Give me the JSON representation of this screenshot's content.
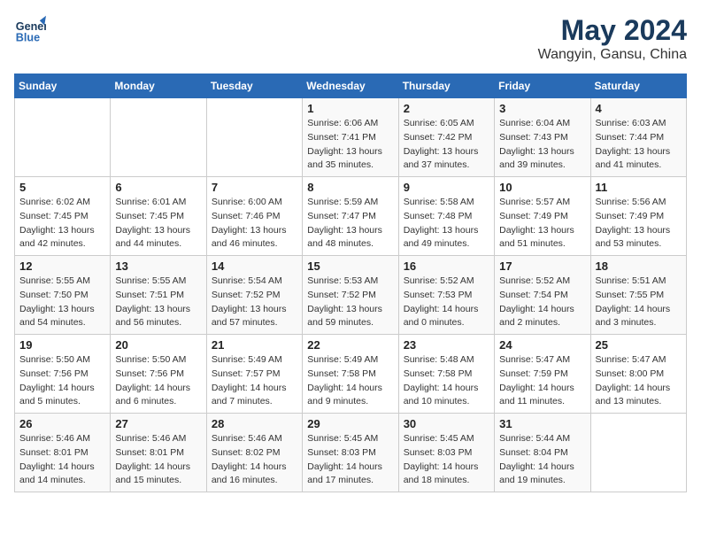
{
  "logo": {
    "line1": "General",
    "line2": "Blue"
  },
  "title": "May 2024",
  "subtitle": "Wangyin, Gansu, China",
  "weekdays": [
    "Sunday",
    "Monday",
    "Tuesday",
    "Wednesday",
    "Thursday",
    "Friday",
    "Saturday"
  ],
  "weeks": [
    [
      {
        "day": "",
        "info": ""
      },
      {
        "day": "",
        "info": ""
      },
      {
        "day": "",
        "info": ""
      },
      {
        "day": "1",
        "info": "Sunrise: 6:06 AM\nSunset: 7:41 PM\nDaylight: 13 hours\nand 35 minutes."
      },
      {
        "day": "2",
        "info": "Sunrise: 6:05 AM\nSunset: 7:42 PM\nDaylight: 13 hours\nand 37 minutes."
      },
      {
        "day": "3",
        "info": "Sunrise: 6:04 AM\nSunset: 7:43 PM\nDaylight: 13 hours\nand 39 minutes."
      },
      {
        "day": "4",
        "info": "Sunrise: 6:03 AM\nSunset: 7:44 PM\nDaylight: 13 hours\nand 41 minutes."
      }
    ],
    [
      {
        "day": "5",
        "info": "Sunrise: 6:02 AM\nSunset: 7:45 PM\nDaylight: 13 hours\nand 42 minutes."
      },
      {
        "day": "6",
        "info": "Sunrise: 6:01 AM\nSunset: 7:45 PM\nDaylight: 13 hours\nand 44 minutes."
      },
      {
        "day": "7",
        "info": "Sunrise: 6:00 AM\nSunset: 7:46 PM\nDaylight: 13 hours\nand 46 minutes."
      },
      {
        "day": "8",
        "info": "Sunrise: 5:59 AM\nSunset: 7:47 PM\nDaylight: 13 hours\nand 48 minutes."
      },
      {
        "day": "9",
        "info": "Sunrise: 5:58 AM\nSunset: 7:48 PM\nDaylight: 13 hours\nand 49 minutes."
      },
      {
        "day": "10",
        "info": "Sunrise: 5:57 AM\nSunset: 7:49 PM\nDaylight: 13 hours\nand 51 minutes."
      },
      {
        "day": "11",
        "info": "Sunrise: 5:56 AM\nSunset: 7:49 PM\nDaylight: 13 hours\nand 53 minutes."
      }
    ],
    [
      {
        "day": "12",
        "info": "Sunrise: 5:55 AM\nSunset: 7:50 PM\nDaylight: 13 hours\nand 54 minutes."
      },
      {
        "day": "13",
        "info": "Sunrise: 5:55 AM\nSunset: 7:51 PM\nDaylight: 13 hours\nand 56 minutes."
      },
      {
        "day": "14",
        "info": "Sunrise: 5:54 AM\nSunset: 7:52 PM\nDaylight: 13 hours\nand 57 minutes."
      },
      {
        "day": "15",
        "info": "Sunrise: 5:53 AM\nSunset: 7:52 PM\nDaylight: 13 hours\nand 59 minutes."
      },
      {
        "day": "16",
        "info": "Sunrise: 5:52 AM\nSunset: 7:53 PM\nDaylight: 14 hours\nand 0 minutes."
      },
      {
        "day": "17",
        "info": "Sunrise: 5:52 AM\nSunset: 7:54 PM\nDaylight: 14 hours\nand 2 minutes."
      },
      {
        "day": "18",
        "info": "Sunrise: 5:51 AM\nSunset: 7:55 PM\nDaylight: 14 hours\nand 3 minutes."
      }
    ],
    [
      {
        "day": "19",
        "info": "Sunrise: 5:50 AM\nSunset: 7:56 PM\nDaylight: 14 hours\nand 5 minutes."
      },
      {
        "day": "20",
        "info": "Sunrise: 5:50 AM\nSunset: 7:56 PM\nDaylight: 14 hours\nand 6 minutes."
      },
      {
        "day": "21",
        "info": "Sunrise: 5:49 AM\nSunset: 7:57 PM\nDaylight: 14 hours\nand 7 minutes."
      },
      {
        "day": "22",
        "info": "Sunrise: 5:49 AM\nSunset: 7:58 PM\nDaylight: 14 hours\nand 9 minutes."
      },
      {
        "day": "23",
        "info": "Sunrise: 5:48 AM\nSunset: 7:58 PM\nDaylight: 14 hours\nand 10 minutes."
      },
      {
        "day": "24",
        "info": "Sunrise: 5:47 AM\nSunset: 7:59 PM\nDaylight: 14 hours\nand 11 minutes."
      },
      {
        "day": "25",
        "info": "Sunrise: 5:47 AM\nSunset: 8:00 PM\nDaylight: 14 hours\nand 13 minutes."
      }
    ],
    [
      {
        "day": "26",
        "info": "Sunrise: 5:46 AM\nSunset: 8:01 PM\nDaylight: 14 hours\nand 14 minutes."
      },
      {
        "day": "27",
        "info": "Sunrise: 5:46 AM\nSunset: 8:01 PM\nDaylight: 14 hours\nand 15 minutes."
      },
      {
        "day": "28",
        "info": "Sunrise: 5:46 AM\nSunset: 8:02 PM\nDaylight: 14 hours\nand 16 minutes."
      },
      {
        "day": "29",
        "info": "Sunrise: 5:45 AM\nSunset: 8:03 PM\nDaylight: 14 hours\nand 17 minutes."
      },
      {
        "day": "30",
        "info": "Sunrise: 5:45 AM\nSunset: 8:03 PM\nDaylight: 14 hours\nand 18 minutes."
      },
      {
        "day": "31",
        "info": "Sunrise: 5:44 AM\nSunset: 8:04 PM\nDaylight: 14 hours\nand 19 minutes."
      },
      {
        "day": "",
        "info": ""
      }
    ]
  ]
}
